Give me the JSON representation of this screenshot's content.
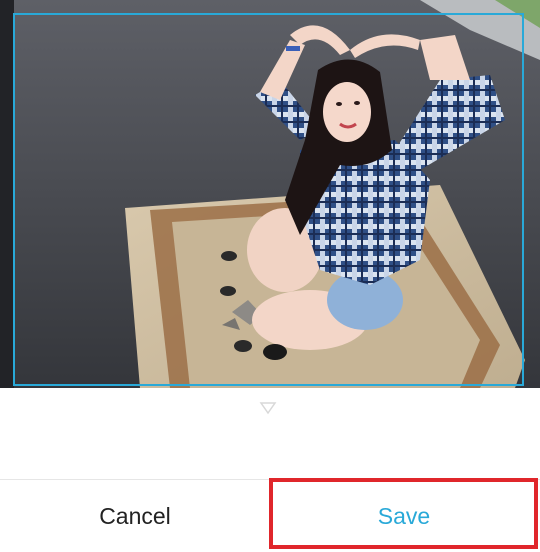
{
  "editor": {
    "photo_description": "photo-preview",
    "cancel_label": "Cancel",
    "save_label": "Save",
    "accent_color": "#29a9d8",
    "highlight_color": "#e0262b",
    "handle_icon": "triangle-down-icon"
  }
}
